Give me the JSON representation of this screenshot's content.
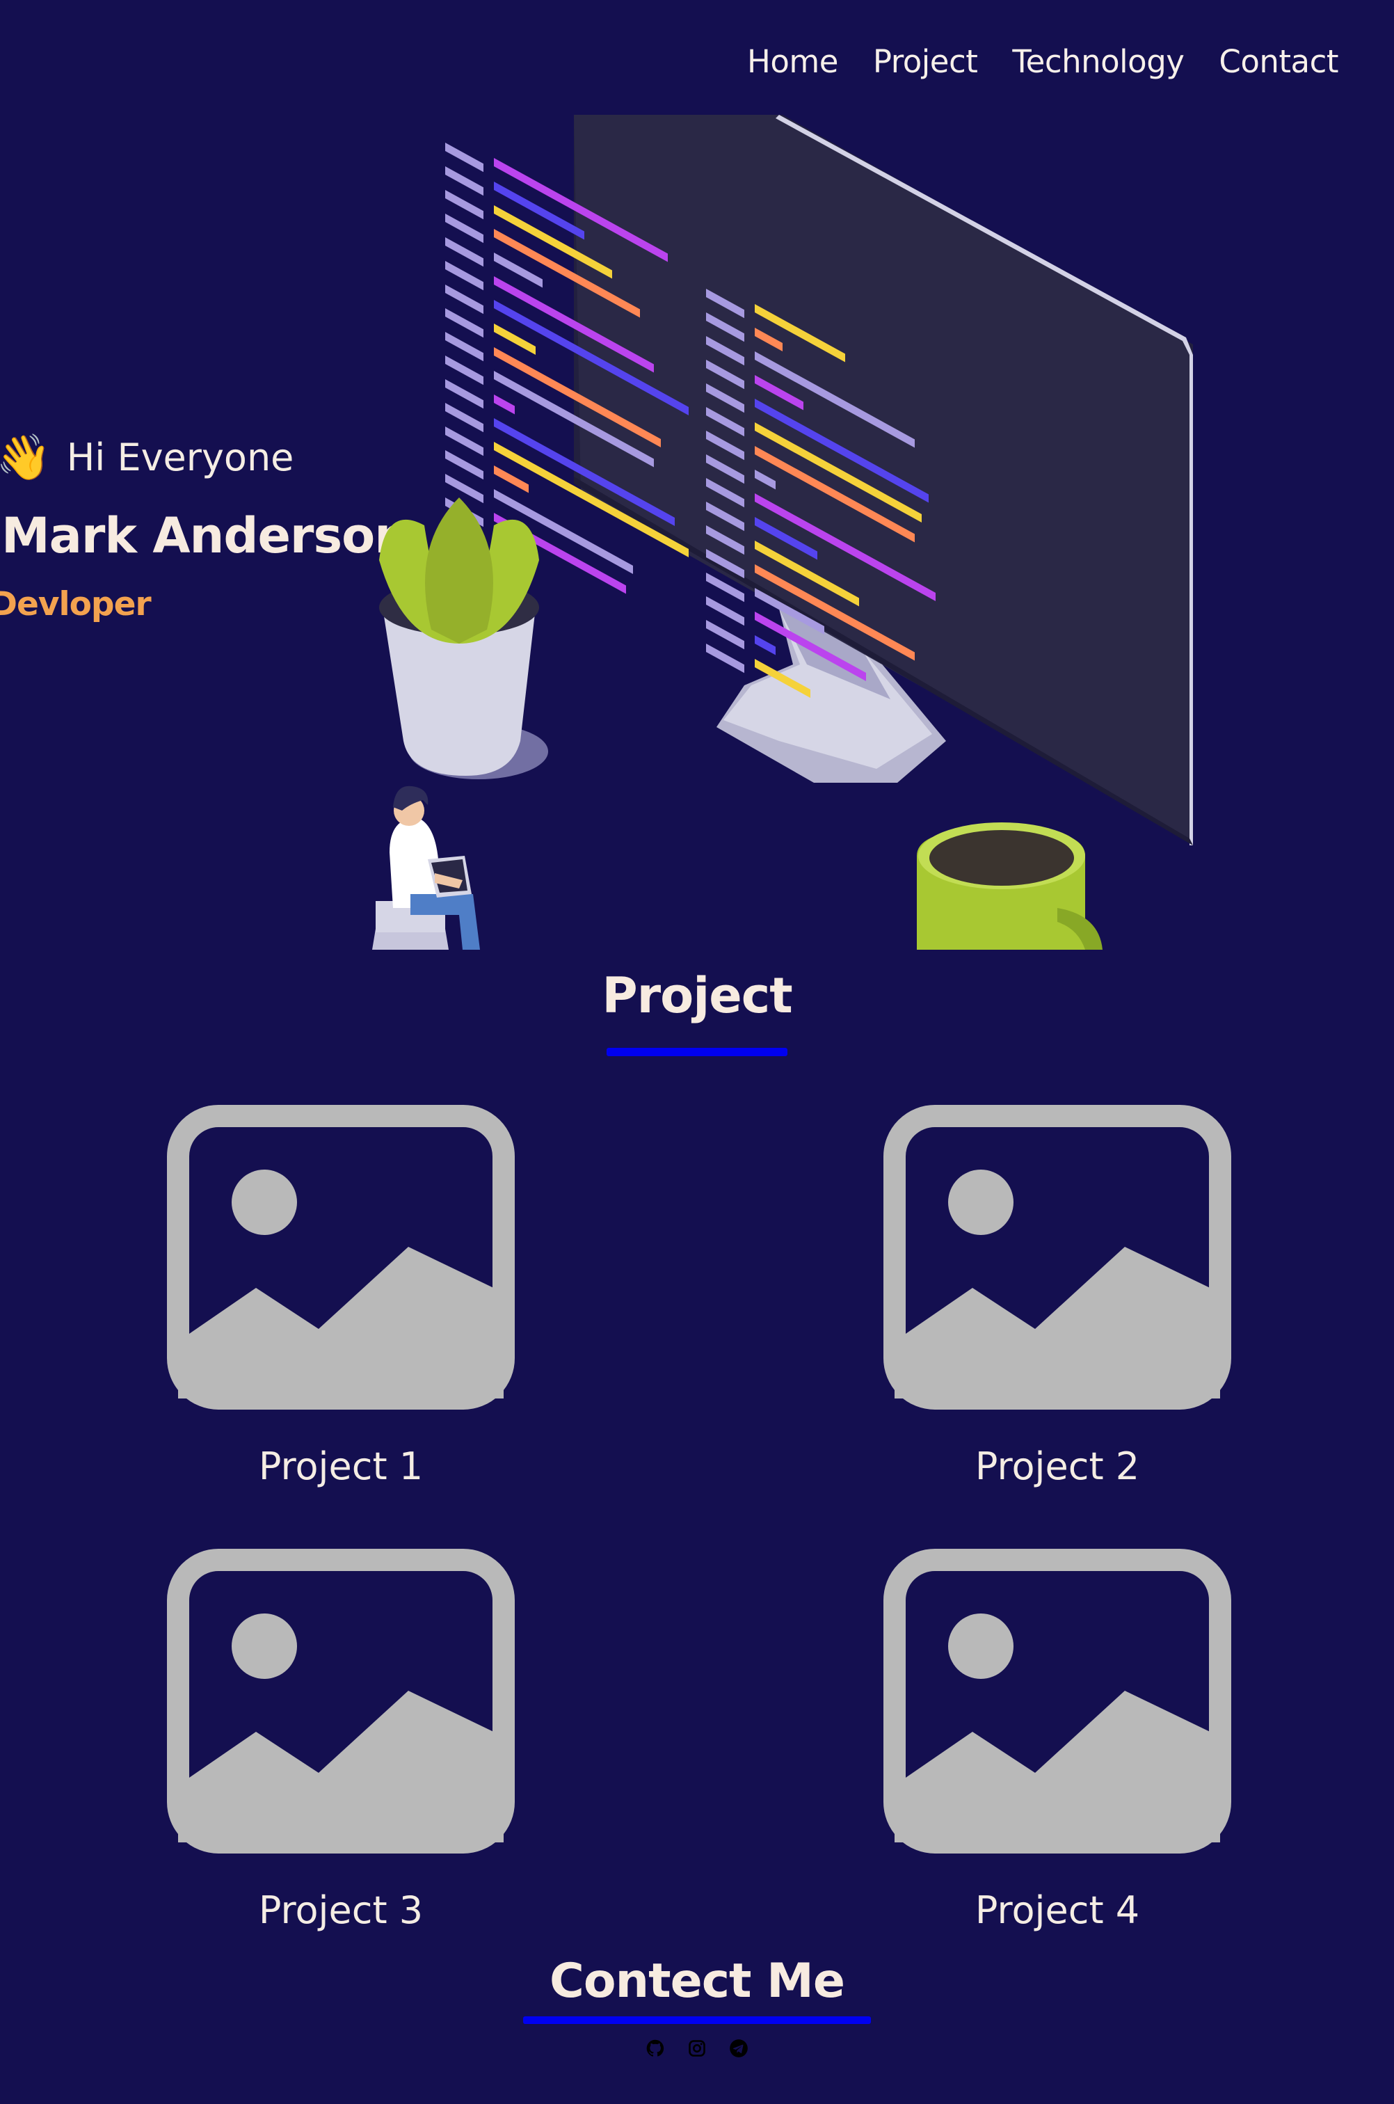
{
  "nav": {
    "items": [
      "Home",
      "Project",
      "Technology",
      "Contact"
    ]
  },
  "hero": {
    "wave_icon": "waving-hand-icon",
    "greeting": "Hi Everyone",
    "name": "Mark Anderson",
    "role": "Devloper"
  },
  "projects": {
    "title": "Project",
    "items": [
      {
        "label": "Project 1",
        "icon": "image-placeholder-icon"
      },
      {
        "label": "Project 2",
        "icon": "image-placeholder-icon"
      },
      {
        "label": "Project 3",
        "icon": "image-placeholder-icon"
      },
      {
        "label": "Project 4",
        "icon": "image-placeholder-icon"
      }
    ]
  },
  "contact": {
    "title": "Contect Me",
    "socials": [
      "github-icon",
      "instagram-icon",
      "telegram-icon"
    ]
  },
  "colors": {
    "background": "#140f50",
    "accent_orange": "#f3a24f",
    "underline_blue": "#0000f0",
    "placeholder_gray": "#b9b9b9"
  }
}
